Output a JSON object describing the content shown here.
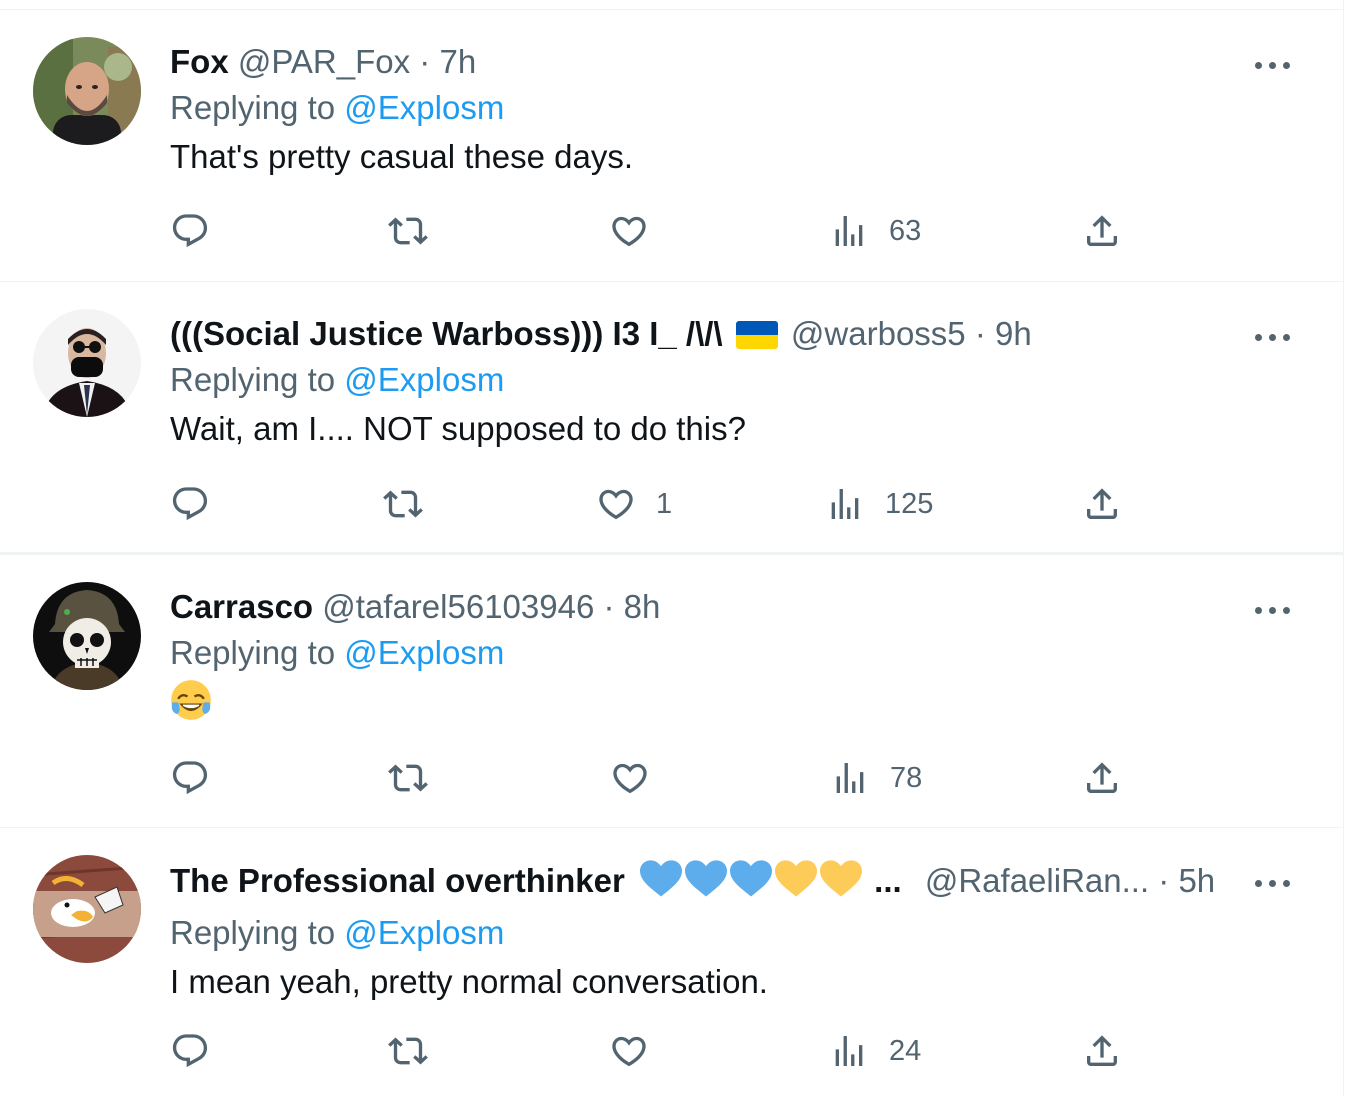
{
  "reply_prefix": "Replying to",
  "tweets": [
    {
      "name": "Fox",
      "handle": "@PAR_Fox",
      "separator": "·",
      "time": "7h",
      "reply_to": "@Explosm",
      "text": "That's pretty casual these days.",
      "reply_count": "",
      "retweet_count": "",
      "like_count": "",
      "view_count": "63",
      "avatar_icon": "bald-man-photo-avatar"
    },
    {
      "name": "(((Social Justice Warboss))) I3 I_ /\\/\\",
      "flag_icon": "ukraine-flag-icon",
      "handle": "@warboss5",
      "separator": "·",
      "time": "9h",
      "reply_to": "@Explosm",
      "text": "Wait, am I.... NOT supposed to do this?",
      "reply_count": "",
      "retweet_count": "",
      "like_count": "1",
      "view_count": "125",
      "avatar_icon": "masked-man-suit-avatar"
    },
    {
      "name": "Carrasco",
      "handle": "@tafarel56103946",
      "separator": "·",
      "time": "8h",
      "reply_to": "@Explosm",
      "text": "",
      "emoji_icon": "face-with-tears-of-joy-emoji",
      "reply_count": "",
      "retweet_count": "",
      "like_count": "",
      "view_count": "78",
      "avatar_icon": "skull-soldier-helmet-avatar"
    },
    {
      "name": "The Professional overthinker",
      "name_ellipsis": "...",
      "hearts_icons": [
        "blue-heart",
        "blue-heart",
        "blue-heart",
        "yellow-heart",
        "yellow-heart"
      ],
      "handle": "@RafaeliRan...",
      "separator": "·",
      "time": "5h",
      "reply_to": "@Explosm",
      "text": "I mean yeah, pretty normal conversation.",
      "reply_count": "",
      "retweet_count": "",
      "like_count": "",
      "view_count": "24",
      "avatar_icon": "cartoon-duck-avatar"
    }
  ],
  "colors": {
    "accent": "#1d9bf0",
    "secondary_text": "#536471",
    "primary_text": "#0f1419",
    "divider": "#eff3f4",
    "ukraine_blue": "#0057b7",
    "ukraine_yellow": "#ffd700",
    "heart_blue": "#5dadec",
    "heart_yellow": "#fdcb58"
  }
}
